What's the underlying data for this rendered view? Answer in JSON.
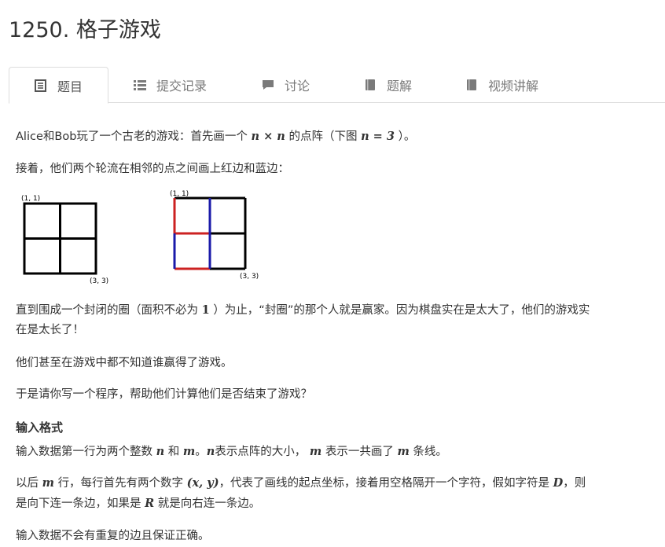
{
  "title": "1250. 格子游戏",
  "tabs": [
    {
      "label": "题目",
      "icon": "document-icon"
    },
    {
      "label": "提交记录",
      "icon": "list-icon"
    },
    {
      "label": "讨论",
      "icon": "chat-icon"
    },
    {
      "label": "题解",
      "icon": "book-icon"
    },
    {
      "label": "视频讲解",
      "icon": "book-icon"
    }
  ],
  "colors": {
    "red_edge": "#cc2222",
    "blue_edge": "#1a1aaa",
    "grid": "#000000"
  },
  "intro": {
    "pre": "Alice和Bob玩了一个古老的游戏：首先画一个",
    "math1": "n × n",
    "mid": "的点阵（下图",
    "math2": "n = 3",
    "post": "）。"
  },
  "p2": "接着，他们两个轮流在相邻的点之间画上红边和蓝边：",
  "figure": {
    "left_top_label": "(1, 1)",
    "left_bottom_label": "(3, 3)",
    "right_top_label": "(1, 1)",
    "right_bottom_label": "(3, 3)"
  },
  "p3": {
    "a": "直到围成一个封闭的圈（面积不必为",
    "math": "1",
    "b": "）为止，“封圈”的那个人就是赢家。因为棋盘实在是太大了，他们的游戏实",
    "line2": "在是太长了！"
  },
  "p4": "他们甚至在游戏中都不知道谁赢得了游戏。",
  "p5": "于是请你写一个程序，帮助他们计算他们是否结束了游戏？",
  "input_heading": "输入格式",
  "p6": {
    "a": "输入数据第一行为两个整数",
    "n": "n",
    "b": "和",
    "m": "m",
    "c": "。",
    "n2": "n",
    "d": "表示点阵的大小，",
    "m2": "m",
    "e": "表示一共画了",
    "m3": "m",
    "f": "条线。"
  },
  "p7": {
    "a": "以后",
    "m": "m",
    "b": "行，每行首先有两个数字",
    "xy": "(x, y)",
    "c": "，代表了画线的起点坐标，接着用空格隔开一个字符，假如字符是",
    "D": "D",
    "d": "，则",
    "line2a": "是向下连一条边，如果是",
    "R": "R",
    "line2b": "就是向右连一条边。"
  },
  "p8": "输入数据不会有重复的边且保证正确。"
}
